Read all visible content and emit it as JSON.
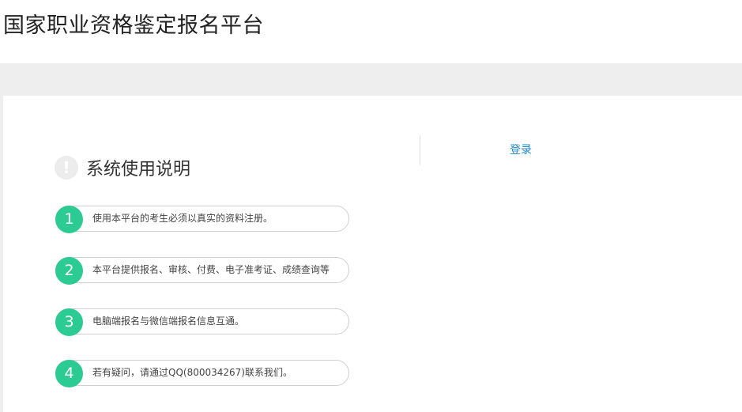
{
  "header": {
    "title": "国家职业资格鉴定报名平台"
  },
  "notice": {
    "icon": "info-icon",
    "icon_glyph": "!",
    "title": "系统使用说明",
    "steps": [
      {
        "number": "1",
        "text": "使用本平台的考生必须以真实的资料注册。"
      },
      {
        "number": "2",
        "text": "本平台提供报名、审核、付费、电子准考证、成绩查询等"
      },
      {
        "number": "3",
        "text": "电脑端报名与微信端报名信息互通。"
      },
      {
        "number": "4",
        "text": "若有疑问，请通过QQ(800034267)联系我们。"
      }
    ]
  },
  "login": {
    "label": "登录"
  },
  "colors": {
    "step_accent": "#2bcb93",
    "link": "#1e88c8",
    "band": "#eeeeee"
  }
}
